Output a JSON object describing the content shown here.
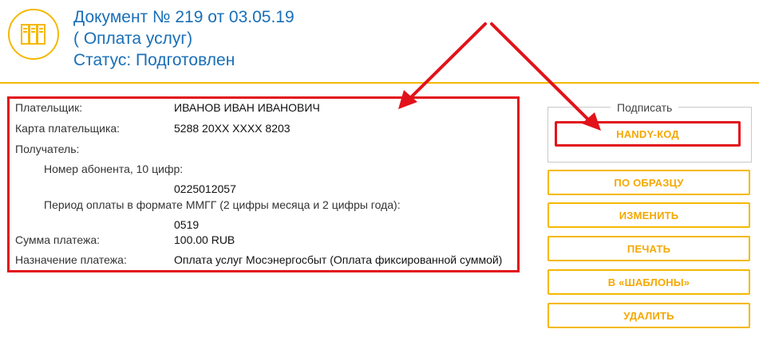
{
  "header": {
    "line1": "Документ № 219 от 03.05.19",
    "line2": "( Оплата услуг)",
    "line3": "Статус: Подготовлен"
  },
  "details": {
    "payer_label": "Плательщик:",
    "payer_value": "ИВАНОВ ИВАН ИВАНОВИЧ",
    "card_label": "Карта плательщика:",
    "card_value": "5288 20XX XXXX 8203",
    "recipient_label": "Получатель:",
    "subscriber_label": "Номер абонента, 10 цифр:",
    "subscriber_value": "0225012057",
    "period_label": "Период оплаты в формате ММГГ (2 цифры месяца и 2 цифры года):",
    "period_value": "0519",
    "amount_label": "Сумма платежа:",
    "amount_value": "100.00 RUB",
    "purpose_label": "Назначение платежа:",
    "purpose_value": "Оплата услуг Мосэнергосбыт (Оплата фиксированной суммой)"
  },
  "actions": {
    "sign_legend": "Подписать",
    "handy_code": "HANDY-КОД",
    "by_sample": "ПО ОБРАЗЦУ",
    "edit": "ИЗМЕНИТЬ",
    "print": "ПЕЧАТЬ",
    "to_templates": "В «ШАБЛОНЫ»",
    "delete": "УДАЛИТЬ"
  },
  "colors": {
    "accent": "#f5b800",
    "title": "#1a6fb7",
    "highlight": "#e2121a"
  },
  "icons": {
    "document": "binders-icon"
  }
}
